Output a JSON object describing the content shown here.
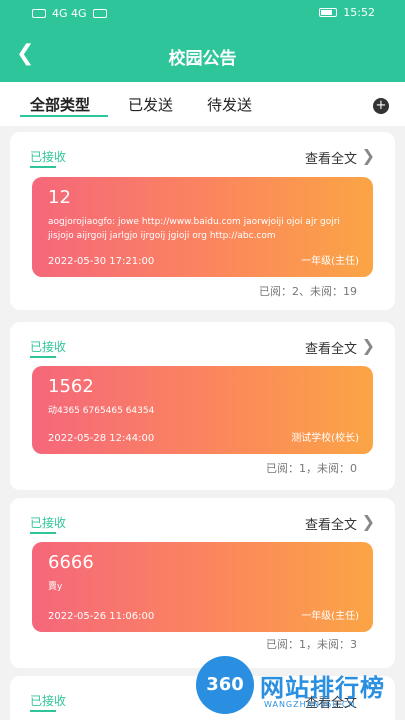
{
  "status_bar": {
    "left_text": "4G 4G",
    "time": "15:52"
  },
  "header": {
    "title": "校园公告",
    "back_icon": "chevron-left-icon"
  },
  "tabs": [
    {
      "label": "全部类型"
    },
    {
      "label": "已发送"
    },
    {
      "label": "待发送"
    }
  ],
  "add_label": "+",
  "cards": [
    {
      "status": "已接收",
      "view_label": "查看全文",
      "title": "12",
      "body": "aogjorojiaogfo: jowe http://www.baidu.com jaorwjoiji ojoi ajr gojri jisjojo aijrgoij jarlgjo ijrgoij jgioji org http://abc.com",
      "date": "2022-05-30 17:21:00",
      "sender": "一年级(主任)",
      "stats": "已阅：2、未阅：19"
    },
    {
      "status": "已接收",
      "view_label": "查看全文",
      "title": "1562",
      "body": "动4365 6765465 64354",
      "date": "2022-05-28 12:44:00",
      "sender": "测试学校(校长)",
      "stats": "已阅：1，未阅：0"
    },
    {
      "status": "已接收",
      "view_label": "查看全文",
      "title": "6666",
      "body": "賣y",
      "date": "2022-05-26 11:06:00",
      "sender": "一年级(主任)",
      "stats": "已阅：1，未阅：3"
    },
    {
      "status": "已接收",
      "view_label": "查看全文"
    }
  ],
  "watermark": {
    "logo": "360",
    "text": "网站排行榜",
    "sub": "WANGZHAN360.CN"
  }
}
